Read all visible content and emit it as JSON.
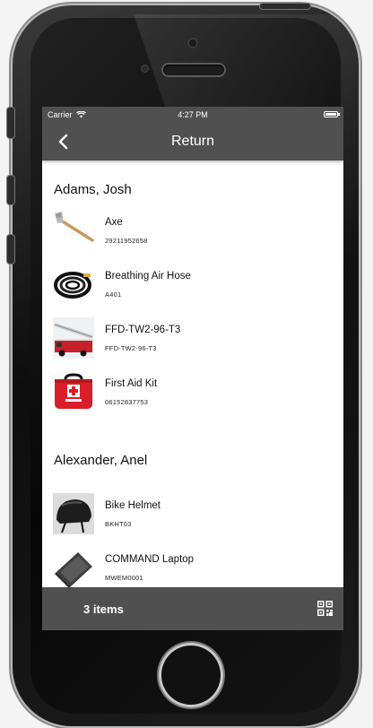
{
  "status": {
    "carrier": "Carrier",
    "time": "4:27 PM"
  },
  "nav": {
    "title": "Return"
  },
  "groups": [
    {
      "name": "Adams, Josh",
      "items": [
        {
          "name": "Axe",
          "code": "29211952658",
          "icon": "axe-image"
        },
        {
          "name": "Breathing Air Hose",
          "code": "A401",
          "icon": "hose-image"
        },
        {
          "name": "FFD-TW2-96-T3",
          "code": "FFD-TW2-96-T3",
          "icon": "fire-truck-image"
        },
        {
          "name": "First Aid Kit",
          "code": "06152837753",
          "icon": "first-aid-kit-image"
        }
      ]
    },
    {
      "name": "Alexander, Anel",
      "items": [
        {
          "name": "Bike Helmet",
          "code": "BKHT03",
          "icon": "helmet-image"
        },
        {
          "name": "COMMAND Laptop",
          "code": "MWEM0001",
          "icon": "laptop-image"
        }
      ]
    }
  ],
  "footer": {
    "count_label": "3 items",
    "qr_icon": "qr-code-icon"
  },
  "colors": {
    "bar": "#505050",
    "screen_bg": "#ffffff"
  }
}
